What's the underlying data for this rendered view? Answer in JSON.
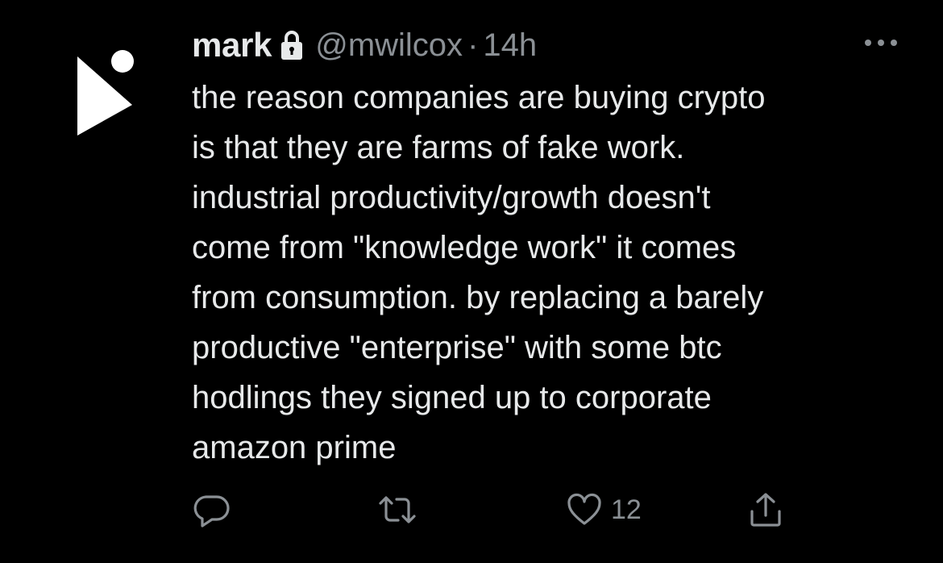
{
  "tweet": {
    "display_name": "mark",
    "handle": "@mwilcox",
    "separator": "·",
    "time": "14h",
    "text_lines": [
      "the reason companies are buying crypto",
      "is that they are farms of fake work.",
      "industrial productivity/growth doesn't",
      "come from \"knowledge work\" it comes",
      "from consumption. by replacing a barely",
      "productive \"enterprise\" with some btc",
      "hodlings they signed up to corporate",
      "amazon prime"
    ],
    "like_count": "12",
    "icons": {
      "avatar": "avatar-logo",
      "protected": "lock-icon",
      "more": "more-icon",
      "reply": "reply-icon",
      "retweet": "retweet-icon",
      "like": "heart-icon",
      "share": "share-icon"
    }
  },
  "theme": {
    "background": "#000000",
    "text": "#e7e9ea",
    "secondary_text": "#8b9095"
  }
}
